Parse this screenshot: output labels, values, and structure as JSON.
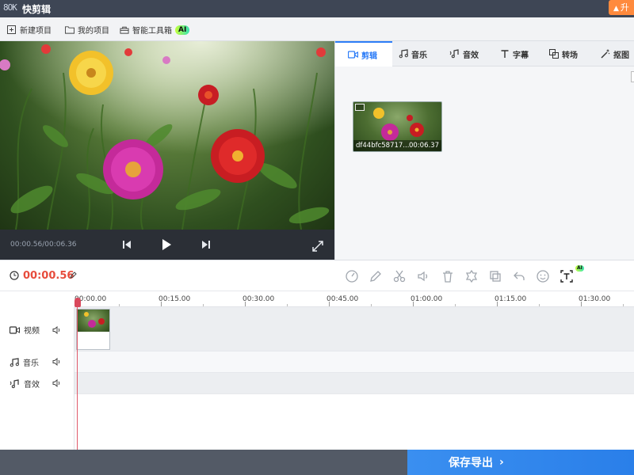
{
  "window": {
    "logo_text": "8OK",
    "title": "快剪辑",
    "upgrade_label": "升"
  },
  "toolbar": {
    "new_project": "新建项目",
    "my_projects": "我的项目",
    "smart_toolbox": "智能工具箱",
    "ai_badge": "AI"
  },
  "player": {
    "time_readout": "00:00.56/00:06.36"
  },
  "panel": {
    "tabs": [
      {
        "label": "剪辑",
        "icon": "video-camera-icon",
        "active": true
      },
      {
        "label": "音乐",
        "icon": "music-note-icon",
        "active": false
      },
      {
        "label": "音效",
        "icon": "sound-effect-icon",
        "active": false
      },
      {
        "label": "字幕",
        "icon": "text-icon",
        "active": false
      },
      {
        "label": "转场",
        "icon": "transition-icon",
        "active": false
      },
      {
        "label": "抠图",
        "icon": "magic-wand-icon",
        "active": false
      }
    ],
    "clip": {
      "name": "df44bfc58717...",
      "duration": "00:06.37"
    }
  },
  "edit_bar": {
    "current_time": "00:00.56",
    "ai_badge": "AI",
    "tools": [
      "speed-icon",
      "pencil-icon",
      "scissors-icon",
      "volume-icon",
      "trash-icon",
      "crop-icon",
      "copy-icon",
      "undo-icon",
      "emoji-icon",
      "ai-text-icon"
    ]
  },
  "timeline": {
    "ruler_labels": [
      "00:00.00",
      "00:15.00",
      "00:30.00",
      "00:45.00",
      "01:00.00",
      "01:15.00",
      "01:30.00"
    ],
    "tracks": [
      {
        "label": "视频",
        "icon": "video-camera-icon"
      },
      {
        "label": "音乐",
        "icon": "music-note-icon"
      },
      {
        "label": "音效",
        "icon": "sound-effect-icon"
      }
    ]
  },
  "footer": {
    "save_export": "保存导出",
    "chevron": "›"
  },
  "colors": {
    "accent": "#2d7df7",
    "time_red": "#e74c3c",
    "titlebar": "#3e4655",
    "export_button": "#3a8ff0",
    "ai_badge": "#c6ff3a"
  }
}
